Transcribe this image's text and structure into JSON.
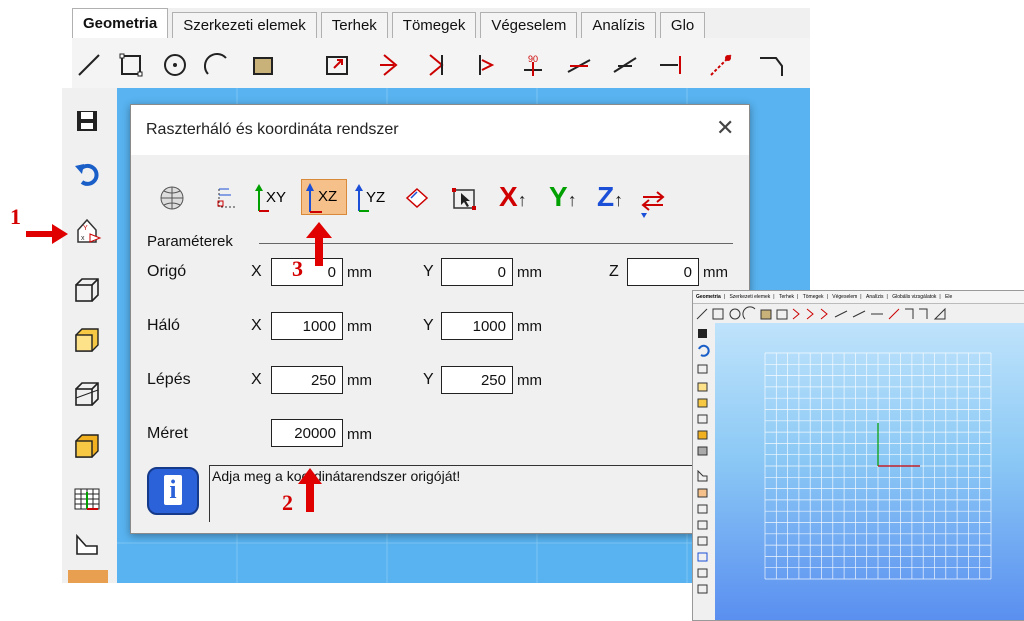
{
  "tabs": [
    "Geometria",
    "Szerkezeti elemek",
    "Terhek",
    "Tömegek",
    "Végeselem",
    "Analízis",
    "Glo"
  ],
  "dialog": {
    "title": "Raszterháló és koordináta rendszer",
    "close": "✕",
    "section": "Paraméterek",
    "axis_buttons": [
      "XY",
      "XZ",
      "YZ"
    ],
    "axis_letters": [
      "X",
      "Y",
      "Z"
    ],
    "rows": {
      "origo": {
        "label": "Origó",
        "x": "0",
        "y": "0",
        "z": "0"
      },
      "halo": {
        "label": "Háló",
        "x": "1000",
        "y": "1000"
      },
      "lepes": {
        "label": "Lépés",
        "x": "250",
        "y": "250"
      },
      "meret": {
        "label": "Méret",
        "value": "20000"
      }
    },
    "axis_names": {
      "x": "X",
      "y": "Y",
      "z": "Z"
    },
    "unit": "mm",
    "info_text": "Adja meg a koordinátarendszer origóját!"
  },
  "annotations": {
    "one": "1",
    "two": "2",
    "three": "3"
  },
  "inset": {
    "tabs": [
      "Geometria",
      "Szerkezeti elemek",
      "Terhek",
      "Tömegek",
      "Végeselem",
      "Analízis",
      "Globális vizsgálatok",
      "Ele"
    ]
  },
  "colors": {
    "canvas": "#58b3f0",
    "arrow": "#e00000",
    "axis_green": "#00a000",
    "axis_red": "#d00000",
    "axis_blue": "#1b4fd8",
    "highlight": "#f6c08a"
  }
}
